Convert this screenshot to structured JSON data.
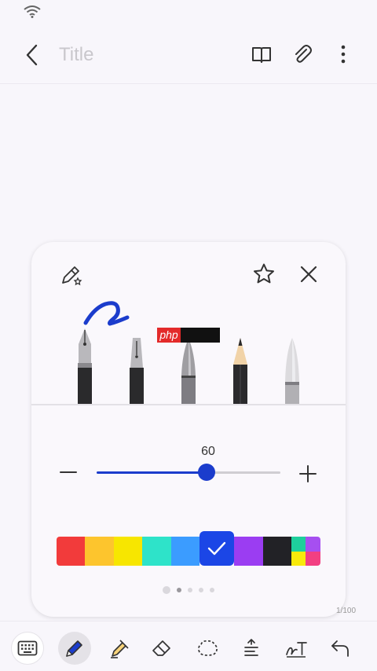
{
  "header": {
    "title_placeholder": "Title"
  },
  "pen_panel": {
    "size_value": "60",
    "size_level": 60,
    "pens": [
      "fountain-pen",
      "calligraphy-pen",
      "brush-pen",
      "pencil",
      "marker"
    ],
    "colors": [
      "#f23b3b",
      "#fdc52d",
      "#f7e600",
      "#2ee3c9",
      "#3b9cff",
      "#1b46e6",
      "#9b3df2",
      "#222226"
    ],
    "multi_color": [
      "#1ecf9c",
      "#a64ff0",
      "#f8e90b",
      "#f23f82"
    ],
    "selected_color": "#1b46e6",
    "page_dots": 4,
    "active_dot": 0
  },
  "watermark": {
    "text": "php"
  },
  "page_counter": "1/100",
  "accent": "#1b3ccc"
}
